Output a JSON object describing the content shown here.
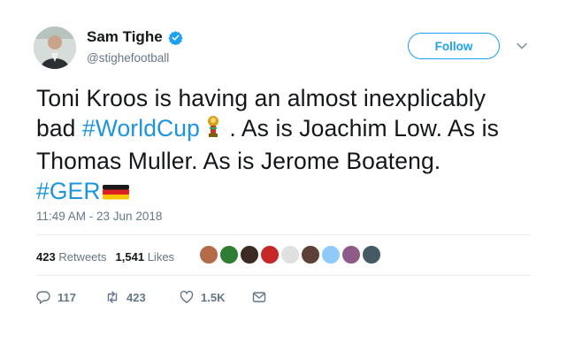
{
  "header": {
    "display_name": "Sam Tighe",
    "handle": "@stighefootball",
    "follow_label": "Follow"
  },
  "tweet": {
    "line1": "Toni Kroos is having an almost inexplicably",
    "line2_pre": "bad ",
    "hashtag1": "#WorldCup",
    "line2_post": " . As is Joachim Low. As is",
    "line3": "Thomas Muller. As is Jerome Boateng.",
    "hashtag2": "#GER",
    "timestamp": "11:49 AM - 23 Jun 2018"
  },
  "stats": {
    "retweets_count": "423",
    "retweets_label": "Retweets",
    "likes_count": "1,541",
    "likes_label": "Likes"
  },
  "actions": {
    "reply_count": "117",
    "retweet_count": "423",
    "like_count": "1.5K"
  },
  "colors": {
    "accent": "#1da1f2",
    "hashtag": "#1b95e0",
    "text": "#14171a",
    "muted": "#657786"
  }
}
